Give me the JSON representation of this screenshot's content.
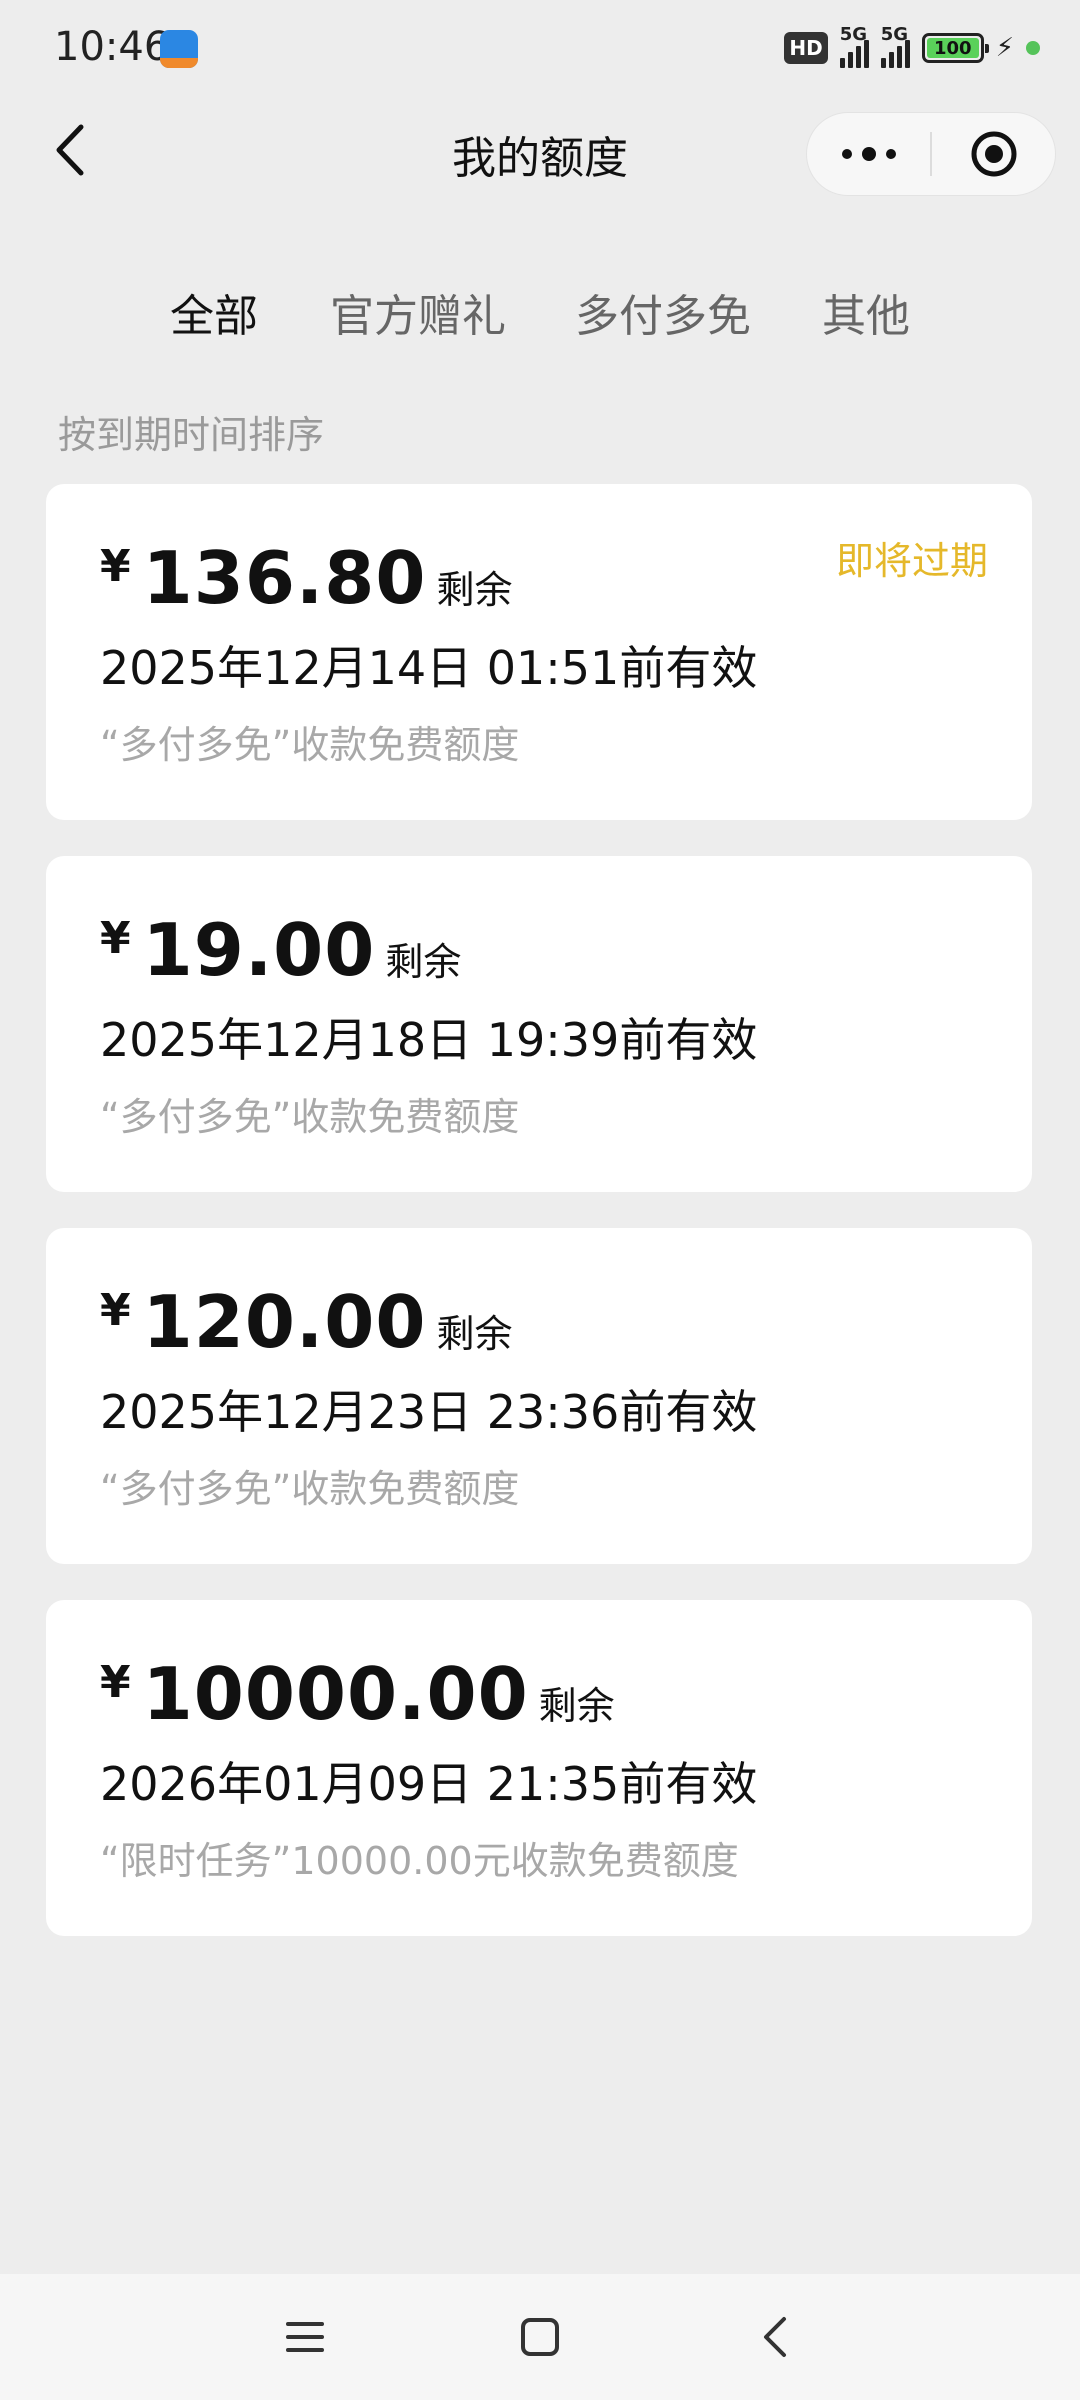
{
  "status_bar": {
    "time": "10:46",
    "hd": "HD",
    "network1": "5G",
    "network2": "5G",
    "battery": "100",
    "battery_level": 100
  },
  "nav": {
    "title": "我的额度",
    "icons": [
      "back-icon",
      "more-icon",
      "miniprogram-close-icon"
    ]
  },
  "tabs": [
    {
      "label": "全部",
      "active": true
    },
    {
      "label": "官方赠礼",
      "active": false
    },
    {
      "label": "多付多免",
      "active": false
    },
    {
      "label": "其他",
      "active": false
    }
  ],
  "sort_label": "按到期时间排序",
  "cards": [
    {
      "currency": "¥",
      "amount": "136.80",
      "remain": "剩余",
      "validity": "2025年12月14日 01:51前有效",
      "desc": "“多付多免”收款免费额度",
      "tag": "即将过期"
    },
    {
      "currency": "¥",
      "amount": "19.00",
      "remain": "剩余",
      "validity": "2025年12月18日 19:39前有效",
      "desc": "“多付多免”收款免费额度",
      "tag": ""
    },
    {
      "currency": "¥",
      "amount": "120.00",
      "remain": "剩余",
      "validity": "2025年12月23日 23:36前有效",
      "desc": "“多付多免”收款免费额度",
      "tag": ""
    },
    {
      "currency": "¥",
      "amount": "10000.00",
      "remain": "剩余",
      "validity": "2026年01月09日 21:35前有效",
      "desc": "“限时任务”10000.00元收款免费额度",
      "tag": ""
    }
  ],
  "colors": {
    "background": "#ededed",
    "card": "#ffffff",
    "expire_tag": "#e5b82a",
    "muted_text": "#a8a8a8"
  },
  "system_nav": [
    "menu-icon",
    "home-icon",
    "back-nav-icon"
  ]
}
